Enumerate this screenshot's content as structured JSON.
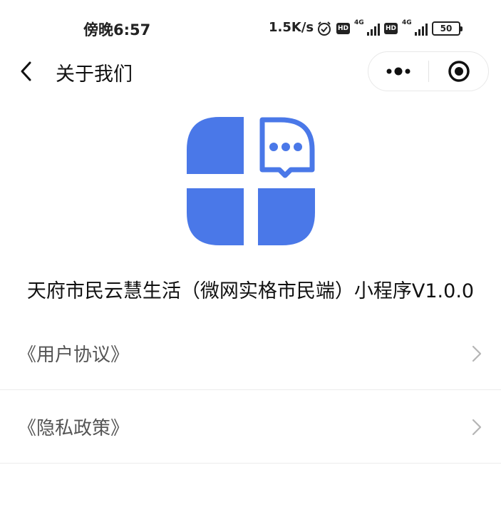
{
  "status_bar": {
    "time": "傍晚6:57",
    "net_speed": "1.5K/s",
    "hd1": "HD",
    "sig1": "4G",
    "hd2": "HD",
    "sig2": "4G",
    "battery": "50",
    "icons": [
      "alarm-icon",
      "hd-icon",
      "signal-icon",
      "hd-icon",
      "signal-icon",
      "battery-icon"
    ]
  },
  "nav": {
    "title": "关于我们",
    "icons": [
      "back-chevron-icon",
      "more-dots-icon",
      "close-target-icon"
    ]
  },
  "brand": {
    "accent": "#4a78e8",
    "app_name": "天府市民云慧生活（微网实格市民端）小程序V1.0.0",
    "logo_icon": "app-logo-icon"
  },
  "menu": {
    "items": [
      {
        "label": "《用户协议》"
      },
      {
        "label": "《隐私政策》"
      }
    ],
    "chevron_icon": "chevron-right-icon"
  }
}
